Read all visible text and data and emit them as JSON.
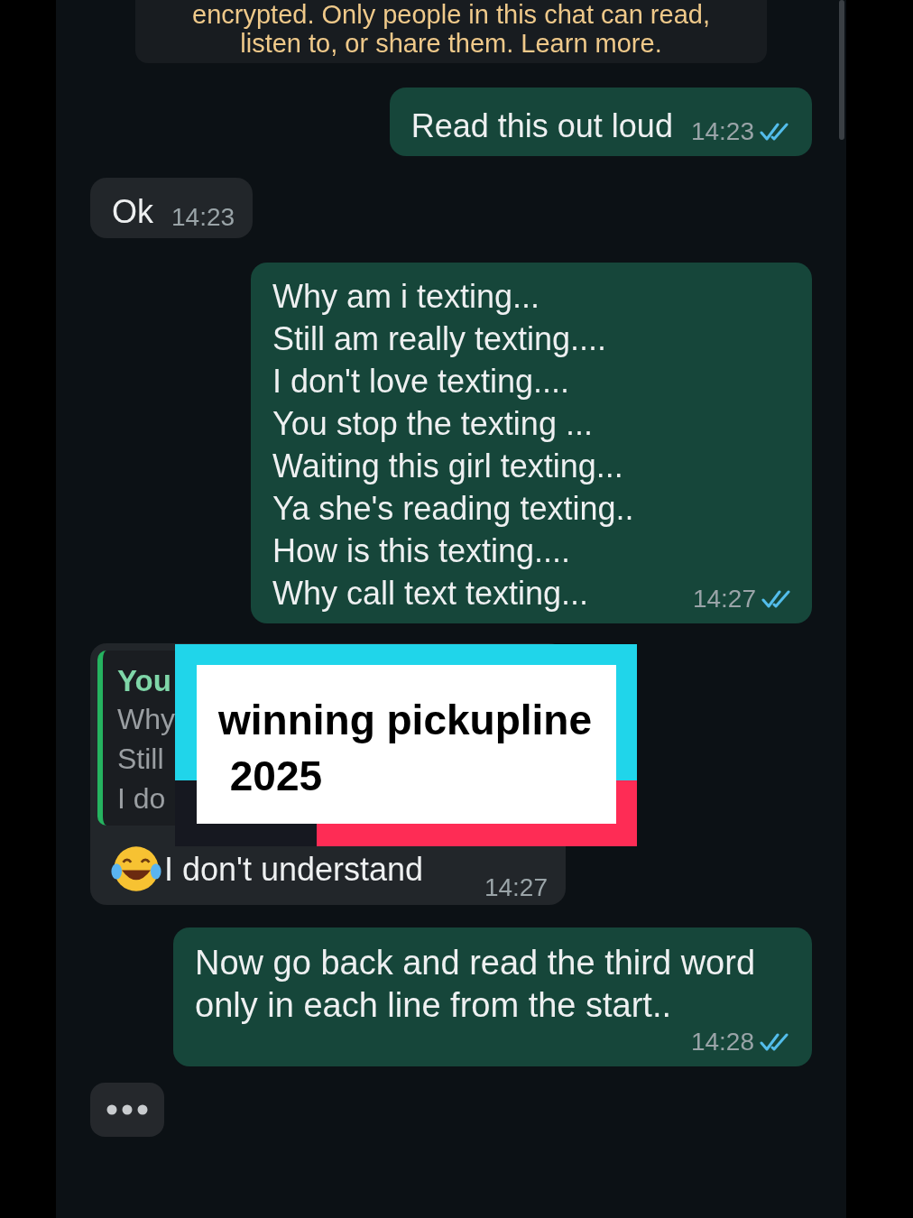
{
  "notice": {
    "lines": [
      "encrypted. Only people in this chat can read,",
      "listen to, or share them. Learn more."
    ]
  },
  "messages": [
    {
      "kind": "sent",
      "text": "Read this out loud",
      "time": "14:23",
      "read": true
    },
    {
      "kind": "received",
      "text": "Ok",
      "time": "14:23"
    },
    {
      "kind": "sent",
      "text": "Why am i texting...\nStill am really texting....\nI don't love texting....\nYou stop the texting ...\nWaiting this girl texting...\nYa she's reading texting..\nHow is this texting....\nWhy call text texting...",
      "time": "14:27",
      "read": true
    },
    {
      "kind": "received_reply",
      "quote_author": "You",
      "quote_lines": [
        "Why",
        "Still",
        "I do"
      ],
      "text": "I don't understand",
      "time": "14:27"
    },
    {
      "kind": "sent",
      "text": "Now go back and read the third word only in each line from the start..",
      "time": "14:28",
      "read": true
    },
    {
      "kind": "typing"
    }
  ],
  "caption": {
    "lines": [
      "winning pickupline",
      " 2025"
    ]
  }
}
